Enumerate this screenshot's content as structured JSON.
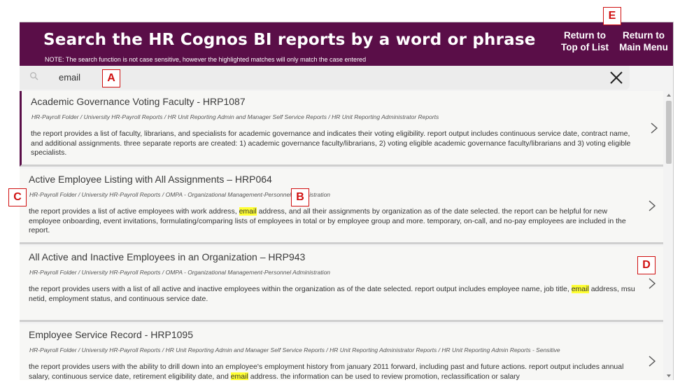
{
  "header": {
    "title": "Search the HR Cognos BI reports by a word or phrase",
    "note": "NOTE: The search function is not case sensitive, however the highlighted matches will only match the case entered",
    "return_top_label": "Return to Top of List",
    "return_main_label": "Return to Main Menu"
  },
  "search": {
    "value": "email",
    "icon": "search-icon",
    "clear_icon": "close-icon"
  },
  "reports": [
    {
      "title": "Academic Governance Voting Faculty - HRP1087",
      "path": "HR-Payroll Folder / University HR-Payroll Reports / HR Unit Reporting Admin and Manager Self Service Reports / HR Unit Reporting Administrator Reports",
      "desc_parts": [
        "the report provides a list of faculty, librarians, and specialists for academic governance and indicates their voting eligibility. report output includes continuous service date, contract name, and additional assignments. three separate reports are created: 1) academic governance faculty/librarians, 2) voting eligible academic governance faculty/librarians and 3) voting eligible specialists."
      ]
    },
    {
      "title": "Active Employee Listing with All Assignments – HRP064",
      "path": "HR-Payroll Folder / University HR-Payroll Reports / OMPA - Organizational Management-Personnel Administration",
      "desc_parts": [
        "the report provides a list of active employees with work address, ",
        "email",
        " address, and all their assignments by organization as of the date selected. the report can be helpful for new employee onboarding, event invitations, formulating/comparing lists of employees in total or by employee group and more. temporary, on-call, and no-pay employees are included in the report."
      ]
    },
    {
      "title": "All Active and Inactive Employees in an Organization – HRP943",
      "path": "HR-Payroll Folder / University HR-Payroll Reports / OMPA - Organizational Management-Personnel Administration",
      "desc_parts": [
        "the report provides users with a list of all active and inactive employees within the organization as of the date selected. report output includes employee name, job title, ",
        "email",
        " address, msu netid, employment status, and continuous service date."
      ]
    },
    {
      "title": "Employee Service Record - HRP1095",
      "path": "HR-Payroll Folder / University HR-Payroll Reports / HR Unit Reporting Admin and Manager Self Service Reports / HR Unit Reporting Administrator Reports / HR Unit Reporting Admin Reports - Sensitive",
      "desc_parts": [
        "the report provides users with the ability to drill down into an employee's employment history from january 2011 forward, including past and future actions. report output includes annual salary, continuous service date, retirement eligibility date, and ",
        "email",
        " address. the information can be used to review promotion, reclassification or salary"
      ]
    }
  ],
  "callouts": [
    "A",
    "B",
    "C",
    "D",
    "E"
  ],
  "colors": {
    "brand": "#5a0e48",
    "highlight": "#ffff33",
    "callout": "#d01010"
  }
}
